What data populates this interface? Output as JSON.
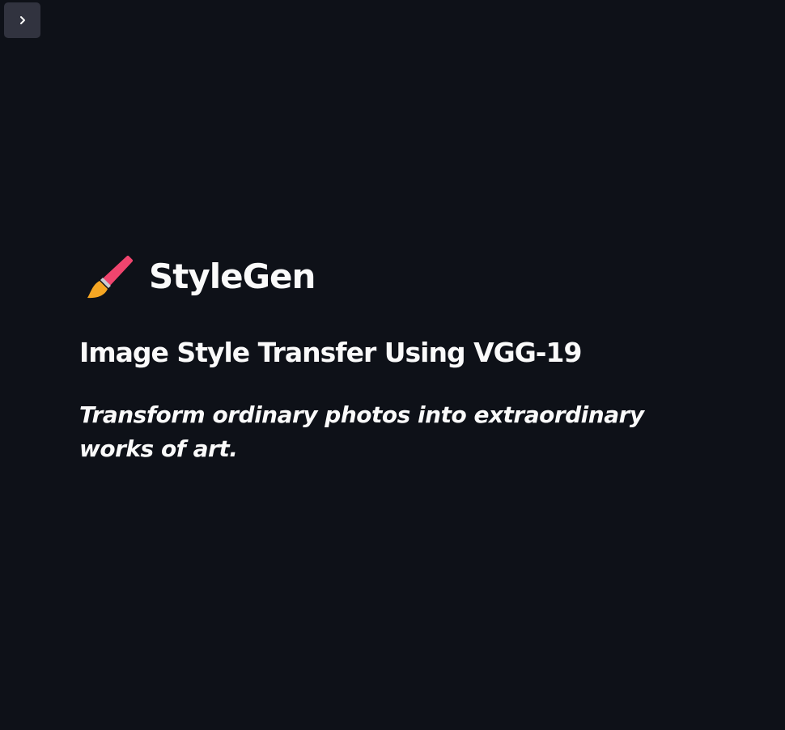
{
  "sidebar": {
    "toggle_icon": "chevron-right-icon"
  },
  "header": {
    "icon": "paintbrush-icon",
    "title": "StyleGen"
  },
  "main": {
    "subtitle": "Image Style Transfer Using VGG-19",
    "tagline": "Transform ordinary photos into extraordinary works of art."
  },
  "colors": {
    "background": "#0e1118",
    "text": "#fafafa",
    "toggle_bg": "#31333f",
    "brush_handle": "#f0456e",
    "brush_ferrule": "#c9ccd1",
    "brush_tip": "#f5a623"
  }
}
